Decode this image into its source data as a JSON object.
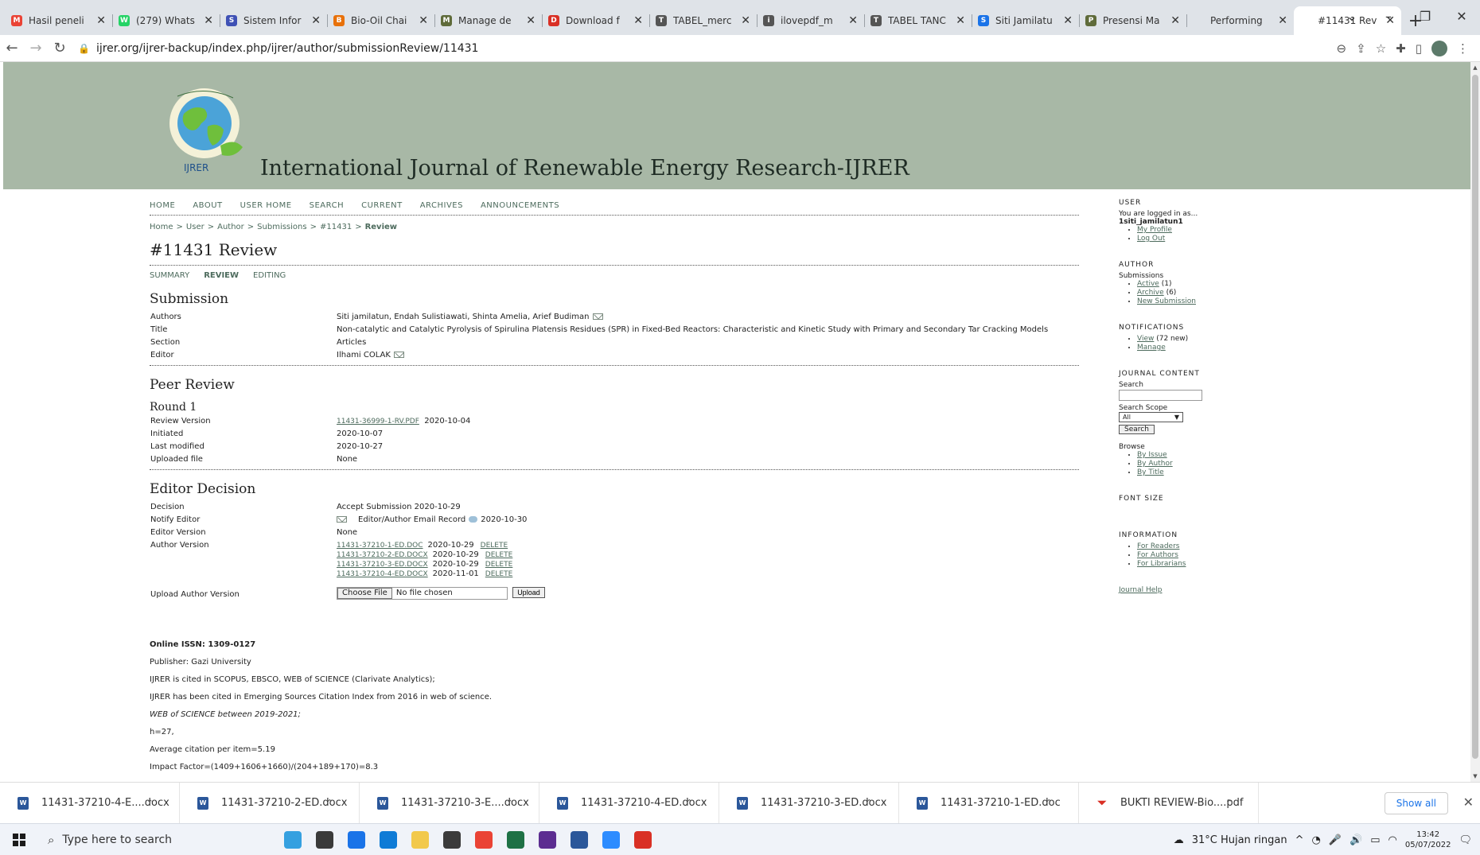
{
  "browser": {
    "tabs": [
      {
        "label": "Hasil peneli",
        "color": "#ea4335",
        "glyph": "M"
      },
      {
        "label": "(279) Whats",
        "color": "#25d366",
        "glyph": "W"
      },
      {
        "label": "Sistem Infor",
        "color": "#3f51b5",
        "glyph": "S"
      },
      {
        "label": "Bio-Oil Chai",
        "color": "#e8710a",
        "glyph": "B"
      },
      {
        "label": "Manage de",
        "color": "#5f6b3a",
        "glyph": "M"
      },
      {
        "label": "Download f",
        "color": "#d93025",
        "glyph": "D"
      },
      {
        "label": "TABEL_merc",
        "color": "#555555",
        "glyph": "T"
      },
      {
        "label": "ilovepdf_m",
        "color": "#555555",
        "glyph": "i"
      },
      {
        "label": "TABEL TANC",
        "color": "#555555",
        "glyph": "T"
      },
      {
        "label": "Siti Jamilatu",
        "color": "#1a73e8",
        "glyph": "S"
      },
      {
        "label": "Presensi Ma",
        "color": "#5f6b3a",
        "glyph": "P"
      },
      {
        "label": "Performing",
        "color": "#dfe3e8",
        "glyph": ""
      },
      {
        "label": "#11431 Rev",
        "color": "#ffffff",
        "glyph": "",
        "active": true
      }
    ],
    "new_tab": "+",
    "window_controls": {
      "list": "⌄",
      "minimize": "–",
      "restore": "❐",
      "close": "✕"
    },
    "url": "ijrer.org/ijrer-backup/index.php/ijrer/author/submissionReview/11431"
  },
  "site": {
    "logo_text": "IJRER",
    "title": "International Journal of Renewable Energy Research-IJRER"
  },
  "nav": [
    "HOME",
    "ABOUT",
    "USER HOME",
    "SEARCH",
    "CURRENT",
    "ARCHIVES",
    "ANNOUNCEMENTS"
  ],
  "breadcrumb": {
    "items": [
      "Home",
      "User",
      "Author",
      "Submissions",
      "#11431"
    ],
    "current": "Review",
    "sep": ">"
  },
  "page_title": "#11431 Review",
  "subtabs": {
    "summary": "SUMMARY",
    "review": "REVIEW",
    "editing": "EDITING"
  },
  "submission": {
    "heading": "Submission",
    "rows": {
      "authors_k": "Authors",
      "authors_v": "Siti jamilatun, Endah Sulistiawati, Shinta Amelia, Arief Budiman",
      "title_k": "Title",
      "title_v": "Non-catalytic and Catalytic Pyrolysis of Spirulina Platensis Residues (SPR) in Fixed-Bed Reactors: Characteristic and Kinetic Study with Primary and Secondary Tar Cracking Models",
      "section_k": "Section",
      "section_v": "Articles",
      "editor_k": "Editor",
      "editor_v": "Ilhami COLAK"
    }
  },
  "peer_review": {
    "heading": "Peer Review",
    "round": "Round 1",
    "review_version_k": "Review Version",
    "review_version_file": "11431-36999-1-RV.PDF",
    "review_version_date": "2020-10-04",
    "initiated_k": "Initiated",
    "initiated_v": "2020-10-07",
    "last_modified_k": "Last modified",
    "last_modified_v": "2020-10-27",
    "uploaded_file_k": "Uploaded file",
    "uploaded_file_v": "None"
  },
  "editor_decision": {
    "heading": "Editor Decision",
    "decision_k": "Decision",
    "decision_v": "Accept Submission 2020-10-29",
    "notify_k": "Notify Editor",
    "notify_record": "Editor/Author Email Record",
    "notify_date": "2020-10-30",
    "editor_version_k": "Editor Version",
    "editor_version_v": "None",
    "author_version_k": "Author Version",
    "author_versions": [
      {
        "file": "11431-37210-1-ED.DOC",
        "date": "2020-10-29",
        "action": "DELETE"
      },
      {
        "file": "11431-37210-2-ED.DOCX",
        "date": "2020-10-29",
        "action": "DELETE"
      },
      {
        "file": "11431-37210-3-ED.DOCX",
        "date": "2020-10-29",
        "action": "DELETE"
      },
      {
        "file": "11431-37210-4-ED.DOCX",
        "date": "2020-11-01",
        "action": "DELETE"
      }
    ],
    "upload_k": "Upload Author Version",
    "choose_file": "Choose File",
    "no_file": "No file chosen",
    "upload_btn": "Upload"
  },
  "footer": {
    "issn": "Online ISSN: 1309-0127",
    "publisher": "Publisher: Gazi University",
    "cited": "IJRER is cited in SCOPUS, EBSCO, WEB of SCIENCE (Clarivate Analytics);",
    "esci": "IJRER has been cited in Emerging Sources Citation Index from 2016 in web of science.",
    "wos": "WEB of SCIENCE between 2019-2021;",
    "h": "h=27,",
    "avg": "Average citation per item=5.19",
    "impact": "Impact Factor=(1409+1606+1660)/(204+189+170)=8.3"
  },
  "sidebar": {
    "user_h": "USER",
    "logged_in": "You are logged in as...",
    "username": "1siti_jamilatun1",
    "my_profile": "My Profile",
    "log_out": "Log Out",
    "author_h": "AUTHOR",
    "submissions": "Submissions",
    "active": "Active",
    "active_count": "(1)",
    "archive": "Archive",
    "archive_count": "(6)",
    "new_submission": "New Submission",
    "notifications_h": "NOTIFICATIONS",
    "view": "View",
    "view_count": "(72 new)",
    "manage": "Manage",
    "journal_content_h": "JOURNAL CONTENT",
    "search_label": "Search",
    "search_scope_label": "Search Scope",
    "scope_value": "All",
    "search_btn": "Search",
    "browse": "Browse",
    "by_issue": "By Issue",
    "by_author": "By Author",
    "by_title": "By Title",
    "font_size_h": "FONT SIZE",
    "information_h": "INFORMATION",
    "for_readers": "For Readers",
    "for_authors": "For Authors",
    "for_librarians": "For Librarians",
    "journal_help": "Journal Help"
  },
  "downloads": {
    "items": [
      {
        "name": "11431-37210-4-E....docx",
        "type": "W"
      },
      {
        "name": "11431-37210-2-ED.docx",
        "type": "W"
      },
      {
        "name": "11431-37210-3-E....docx",
        "type": "W"
      },
      {
        "name": "11431-37210-4-ED.docx",
        "type": "W"
      },
      {
        "name": "11431-37210-3-ED.docx",
        "type": "W"
      },
      {
        "name": "11431-37210-1-ED.doc",
        "type": "W"
      },
      {
        "name": "BUKTI REVIEW-Bio....pdf",
        "type": "pdf"
      }
    ],
    "show_all": "Show all"
  },
  "taskbar": {
    "search_placeholder": "Type here to search",
    "weather": "31°C  Hujan ringan",
    "time": "13:42",
    "date": "05/07/2022",
    "apps": [
      "#35a0e0",
      "#3a3a3a",
      "#1a73e8",
      "#0f7bd6",
      "#f2c94c",
      "#3b3b3b",
      "#ea4335",
      "#1e7145",
      "#5c2d91",
      "#2b579a",
      "#2d8cff",
      "#d93025"
    ]
  }
}
